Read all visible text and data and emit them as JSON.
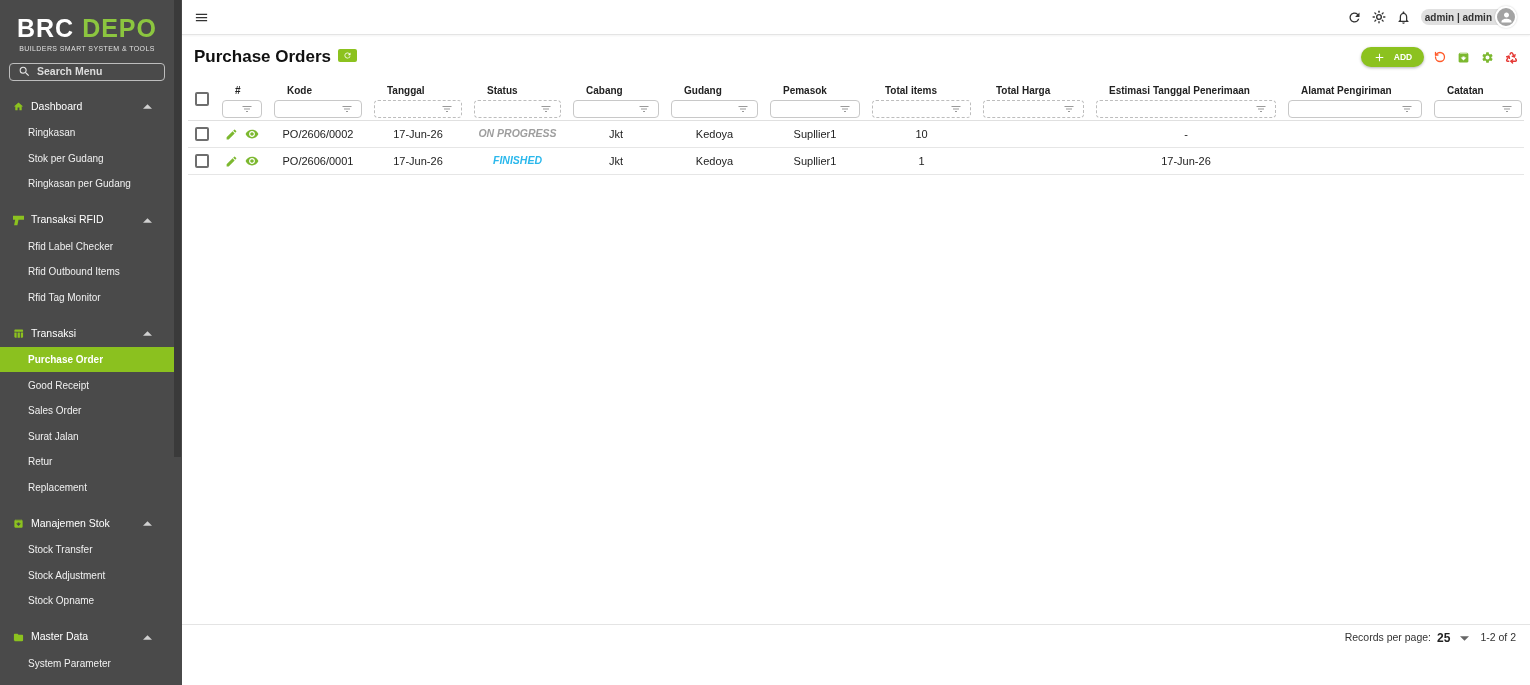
{
  "sidebar": {
    "logo": {
      "text": "BRC",
      "accent": "DEPO",
      "tagline": "BUILDERS SMART SYSTEM & TOOLS"
    },
    "search": {
      "placeholder": "Search Menu"
    },
    "groups": [
      {
        "label": "Dashboard",
        "kind": "home",
        "expanded": true,
        "children": [
          {
            "label": "Ringkasan",
            "selected": false
          },
          {
            "label": "Stok per Gudang",
            "selected": false
          },
          {
            "label": "Ringkasan per Gudang",
            "selected": false
          }
        ]
      },
      {
        "label": "Transaksi RFID",
        "kind": "scanner",
        "expanded": true,
        "children": [
          {
            "label": "Rfid Label Checker",
            "selected": false
          },
          {
            "label": "Rfid Outbound Items",
            "selected": false
          },
          {
            "label": "Rfid Tag Monitor",
            "selected": false
          }
        ]
      },
      {
        "label": "Transaksi",
        "kind": "table",
        "expanded": true,
        "children": [
          {
            "label": "Purchase Order",
            "selected": true
          },
          {
            "label": "Good Receipt",
            "selected": false
          },
          {
            "label": "Sales Order",
            "selected": false
          },
          {
            "label": "Surat Jalan",
            "selected": false
          },
          {
            "label": "Retur",
            "selected": false
          },
          {
            "label": "Replacement",
            "selected": false
          }
        ]
      },
      {
        "label": "Manajemen Stok",
        "kind": "archive",
        "expanded": true,
        "children": [
          {
            "label": "Stock Transfer",
            "selected": false
          },
          {
            "label": "Stock Adjustment",
            "selected": false
          },
          {
            "label": "Stock Opname",
            "selected": false
          }
        ]
      },
      {
        "label": "Master Data",
        "kind": "folder",
        "expanded": true,
        "children": [
          {
            "label": "System Parameter",
            "selected": false
          }
        ]
      }
    ]
  },
  "top_bar": {
    "user": "admin | admin"
  },
  "page": {
    "title": "Purchase Orders",
    "add_button": "ADD"
  },
  "table": {
    "select_all_checked": false,
    "columns": [
      {
        "label": "#",
        "filter_disabled": false
      },
      {
        "label": "Kode",
        "filter_disabled": false
      },
      {
        "label": "Tanggal",
        "filter_disabled": true
      },
      {
        "label": "Status",
        "filter_disabled": true
      },
      {
        "label": "Cabang",
        "filter_disabled": false
      },
      {
        "label": "Gudang",
        "filter_disabled": false
      },
      {
        "label": "Pemasok",
        "filter_disabled": false
      },
      {
        "label": "Total items",
        "filter_disabled": true
      },
      {
        "label": "Total Harga",
        "filter_disabled": true
      },
      {
        "label": "Estimasi Tanggal Penerimaan",
        "filter_disabled": true
      },
      {
        "label": "Alamat Pengiriman",
        "filter_disabled": false
      },
      {
        "label": "Catatan",
        "filter_disabled": false
      }
    ],
    "rows": [
      {
        "checked": false,
        "kode": "PO/2606/0002",
        "tanggal": "17-Jun-26",
        "status": {
          "text": "ON PROGRESS",
          "color": "#9e9e9e"
        },
        "cabang": "Jkt",
        "gudang": "Kedoya",
        "pemasok": "Supllier1",
        "total_items": "10",
        "estimasi_tanggal_penerimaan": "-"
      },
      {
        "checked": false,
        "kode": "PO/2606/0001",
        "tanggal": "17-Jun-26",
        "status": {
          "text": "FINISHED",
          "color": "#2bb8ec"
        },
        "cabang": "Jkt",
        "gudang": "Kedoya",
        "pemasok": "Supllier1",
        "total_items": "1",
        "estimasi_tanggal_penerimaan": "17-Jun-26"
      }
    ]
  },
  "footer": {
    "label": "Records per page:",
    "per_page": "25",
    "range": "1-2 of 2"
  }
}
